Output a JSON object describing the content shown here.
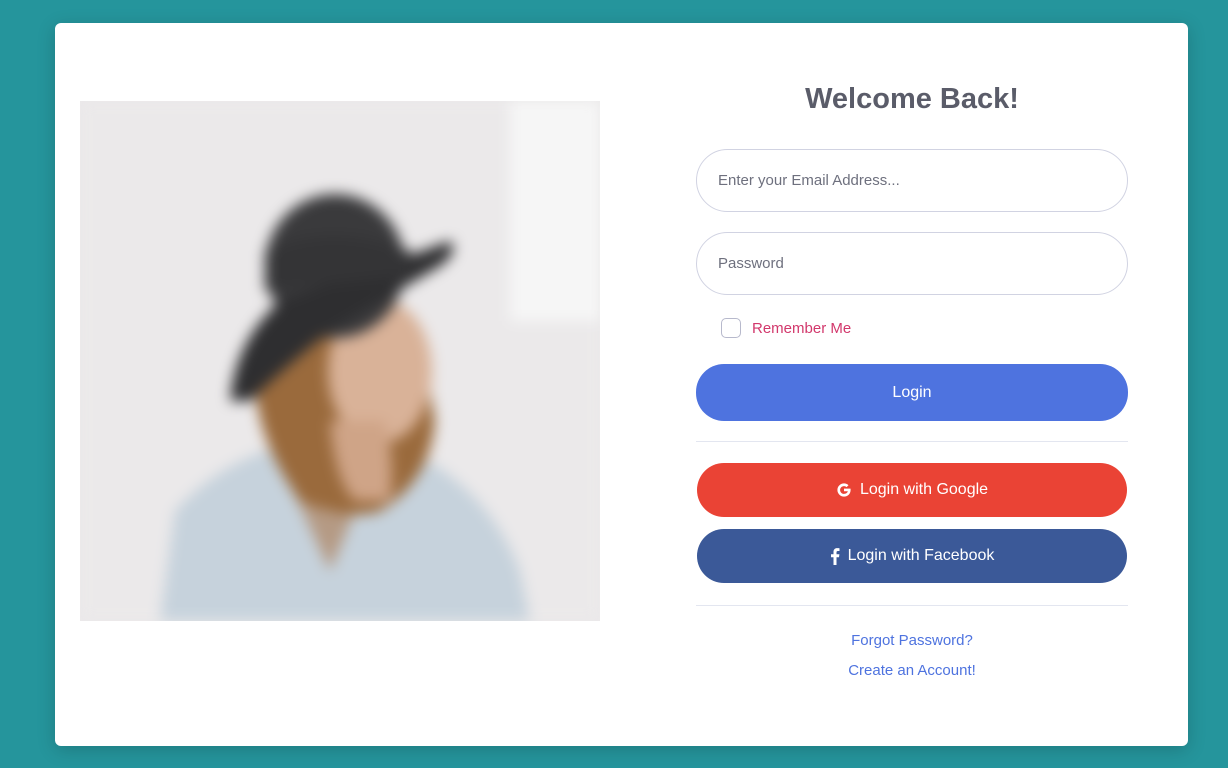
{
  "colors": {
    "background": "#25959c",
    "primary": "#4e73df",
    "google": "#ea4335",
    "facebook": "#3b5998",
    "remember": "#d2386c",
    "link": "#4e73df"
  },
  "login_form": {
    "title": "Welcome Back!",
    "email_placeholder": "Enter your Email Address...",
    "email_value": "",
    "password_placeholder": "Password",
    "password_value": "",
    "remember_label": "Remember Me",
    "remember_checked": false,
    "login_label": "Login",
    "google_label": "Login with Google",
    "google_icon": "google-icon",
    "facebook_label": "Login with Facebook",
    "facebook_icon": "facebook-icon",
    "forgot_label": "Forgot Password?",
    "create_label": "Create an Account!"
  }
}
